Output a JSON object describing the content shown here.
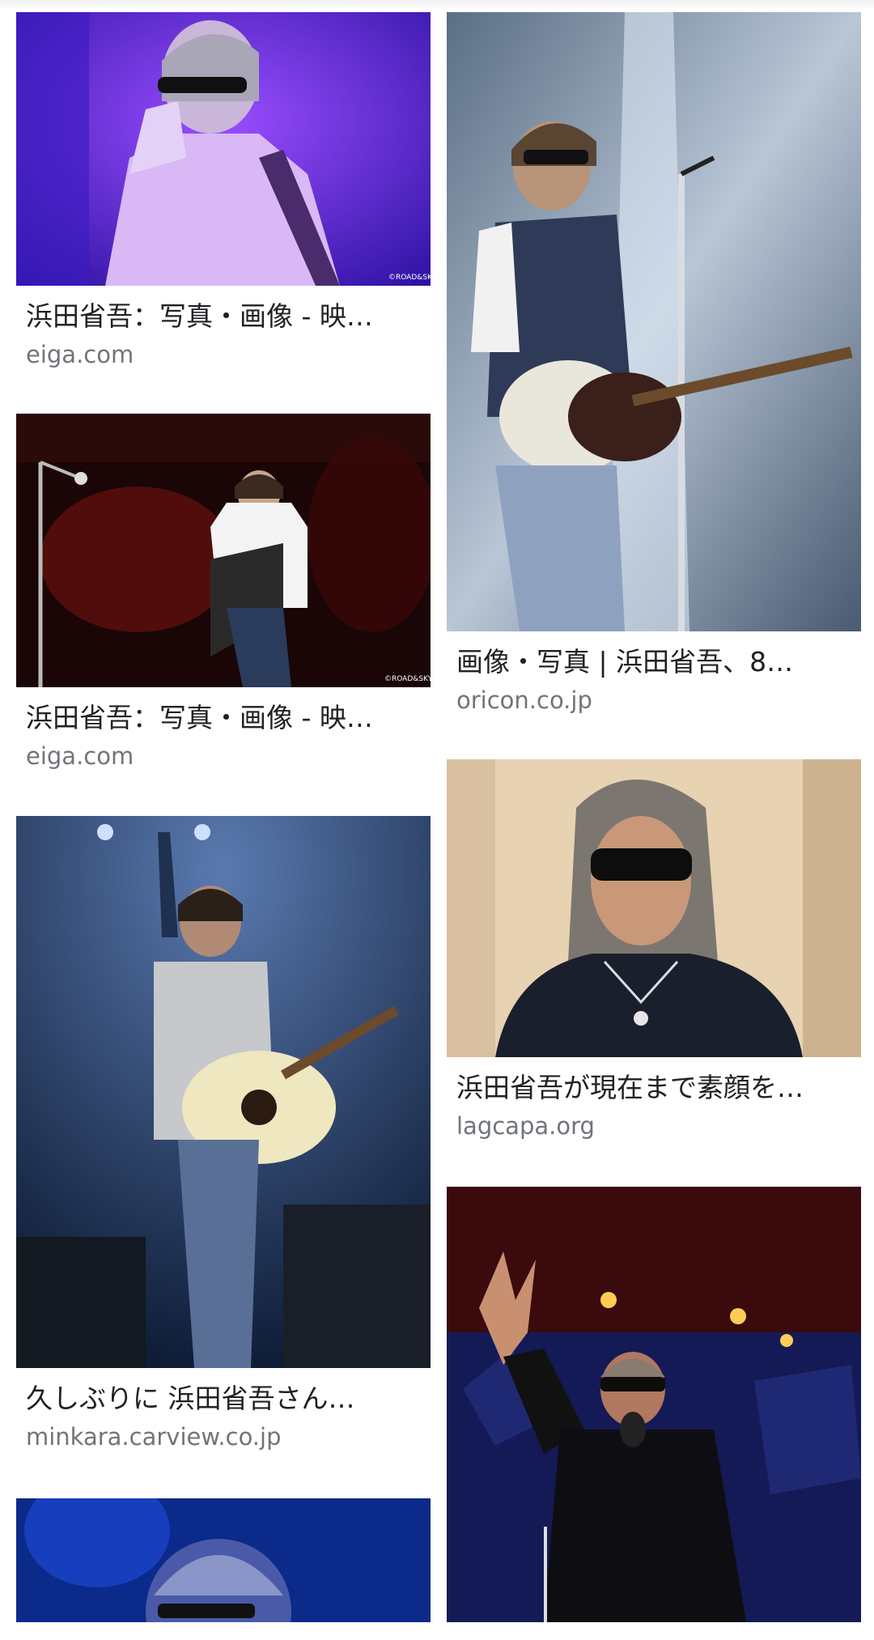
{
  "results": [
    {
      "id": "r1",
      "title": "浜田省吾：写真・画像 - 映…",
      "source": "eiga.com",
      "watermark": "©ROAD&SKY"
    },
    {
      "id": "r2",
      "title": "画像・写真 | 浜田省吾、8…",
      "source": "oricon.co.jp"
    },
    {
      "id": "r3",
      "title": "浜田省吾：写真・画像 - 映…",
      "source": "eiga.com",
      "watermark": "©ROAD&SKY"
    },
    {
      "id": "r4",
      "title": "浜田省吾が現在まで素顔を…",
      "source": "lagcapa.org"
    },
    {
      "id": "r5",
      "title": "久しぶりに 浜田省吾さん…",
      "source": "minkara.carview.co.jp"
    },
    {
      "id": "r6",
      "title": "",
      "source": ""
    },
    {
      "id": "r7",
      "title": "",
      "source": ""
    }
  ],
  "colors": {
    "caption": "#202124",
    "source": "#70757a"
  }
}
